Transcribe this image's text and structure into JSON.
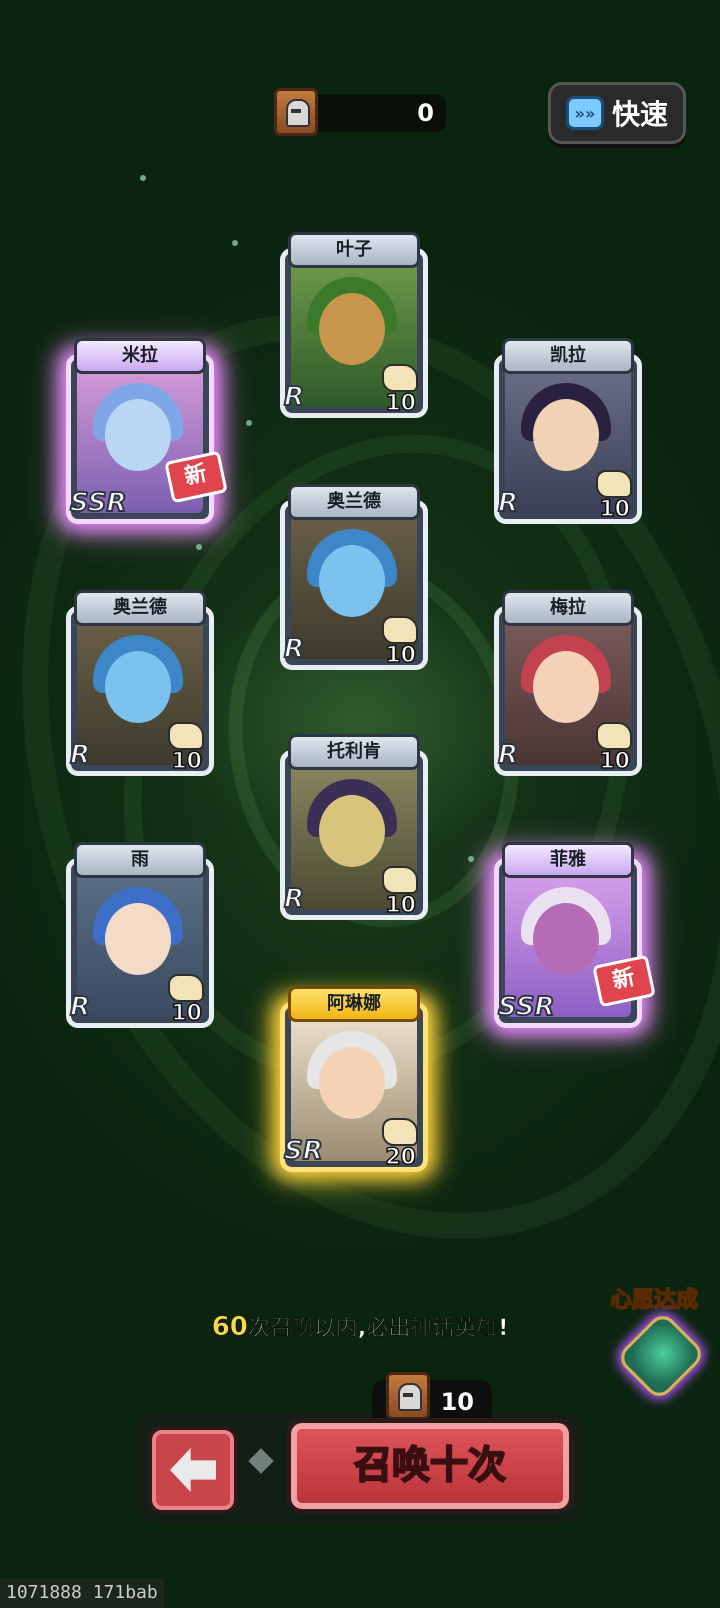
{
  "top_bar": {
    "ticket_count": "0",
    "fast_label": "快速"
  },
  "heroes": [
    {
      "name": "叶子",
      "rarity": "R",
      "count": "10",
      "is_new": false
    },
    {
      "name": "米拉",
      "rarity": "SSR",
      "count": "",
      "is_new": true,
      "new_label": "新"
    },
    {
      "name": "凯拉",
      "rarity": "R",
      "count": "10",
      "is_new": false
    },
    {
      "name": "奥兰德",
      "rarity": "R",
      "count": "10",
      "is_new": false
    },
    {
      "name": "奥兰德",
      "rarity": "R",
      "count": "10",
      "is_new": false
    },
    {
      "name": "梅拉",
      "rarity": "R",
      "count": "10",
      "is_new": false
    },
    {
      "name": "托利肯",
      "rarity": "R",
      "count": "10",
      "is_new": false
    },
    {
      "name": "雨",
      "rarity": "R",
      "count": "10",
      "is_new": false
    },
    {
      "name": "菲雅",
      "rarity": "SSR",
      "count": "",
      "is_new": true,
      "new_label": "新"
    },
    {
      "name": "阿琳娜",
      "rarity": "SR",
      "count": "20",
      "is_new": false
    }
  ],
  "guarantee": {
    "number": "60",
    "text": "次召唤以内,必出神话英雄!"
  },
  "wish": {
    "title": "心愿达成"
  },
  "summon": {
    "cost": "10",
    "label": "召唤十次"
  },
  "watermark": "1071888 171bab",
  "colors": {
    "background": "#123015",
    "summon_button": "#c9454b",
    "ssr_glow": "#e48bff",
    "sr_glow": "#ffd33d",
    "highlight_text": "#ffd94a"
  }
}
